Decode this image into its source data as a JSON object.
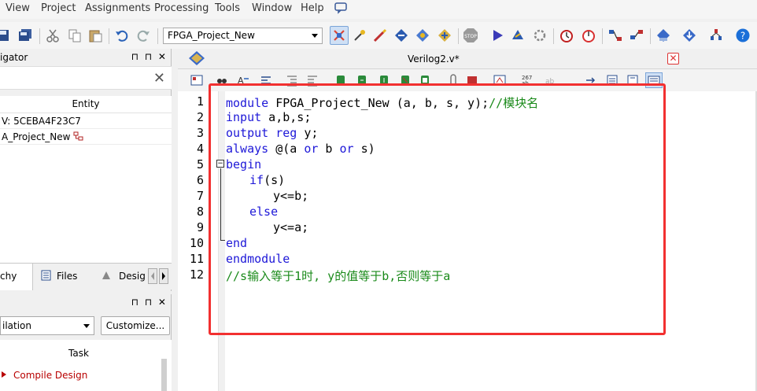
{
  "menu": {
    "items": [
      "View",
      "Project",
      "Assignments",
      "Processing",
      "Tools",
      "Window",
      "Help"
    ]
  },
  "toolbar": {
    "project_selected": "FPGA_Project_New"
  },
  "navigator": {
    "title": "igator",
    "controls": "⊓ ⊓ ✕",
    "clear_icon": "close-icon",
    "entity_header": "Entity",
    "rows": [
      "V: 5CEBA4F23C7",
      "A_Project_New"
    ],
    "tabs": {
      "hierarchy": "chy",
      "files": "Files",
      "design": "Desig"
    }
  },
  "tasks": {
    "controls": "⊓ ⊓ ✕",
    "flow_selected": "ilation",
    "customize_label": "Customize...",
    "task_header": "Task",
    "items": [
      "Compile Design"
    ],
    "accent": "#b80000"
  },
  "editor": {
    "tab_title": "Verilog2.v*",
    "close_label": "✕",
    "line_numbers": [
      "1",
      "2",
      "3",
      "4",
      "5",
      "6",
      "7",
      "8",
      "9",
      "10",
      "11",
      "12"
    ],
    "code": {
      "l1_kw": "module",
      "l1_a": " FPGA_Project_New (a, b, s, y);",
      "l1_cm": "//模块名",
      "l2_kw": "input",
      "l2_a": " a,b,s;",
      "l3_kw1": "output",
      "l3_sp": " ",
      "l3_kw2": "reg",
      "l3_a": " y;",
      "l4_kw": "always",
      "l4_a": " @(a ",
      "l4_kw2": "or",
      "l4_b": " b ",
      "l4_kw3": "or",
      "l4_c": " s)",
      "l5_kw": "begin",
      "l6_kw": "if",
      "l6_a": "(s)",
      "l7_a": "y<=b;",
      "l8_kw": "else",
      "l9_a": "y<=a;",
      "l10_kw": "end",
      "l11_kw": "endmodule",
      "l12_cm": "//s输入等于1时, y的值等于b,否则等于a"
    },
    "keyword_color": "#1e18d8",
    "comment_color": "#1a8a1a",
    "highlight_color": "#f23030"
  }
}
